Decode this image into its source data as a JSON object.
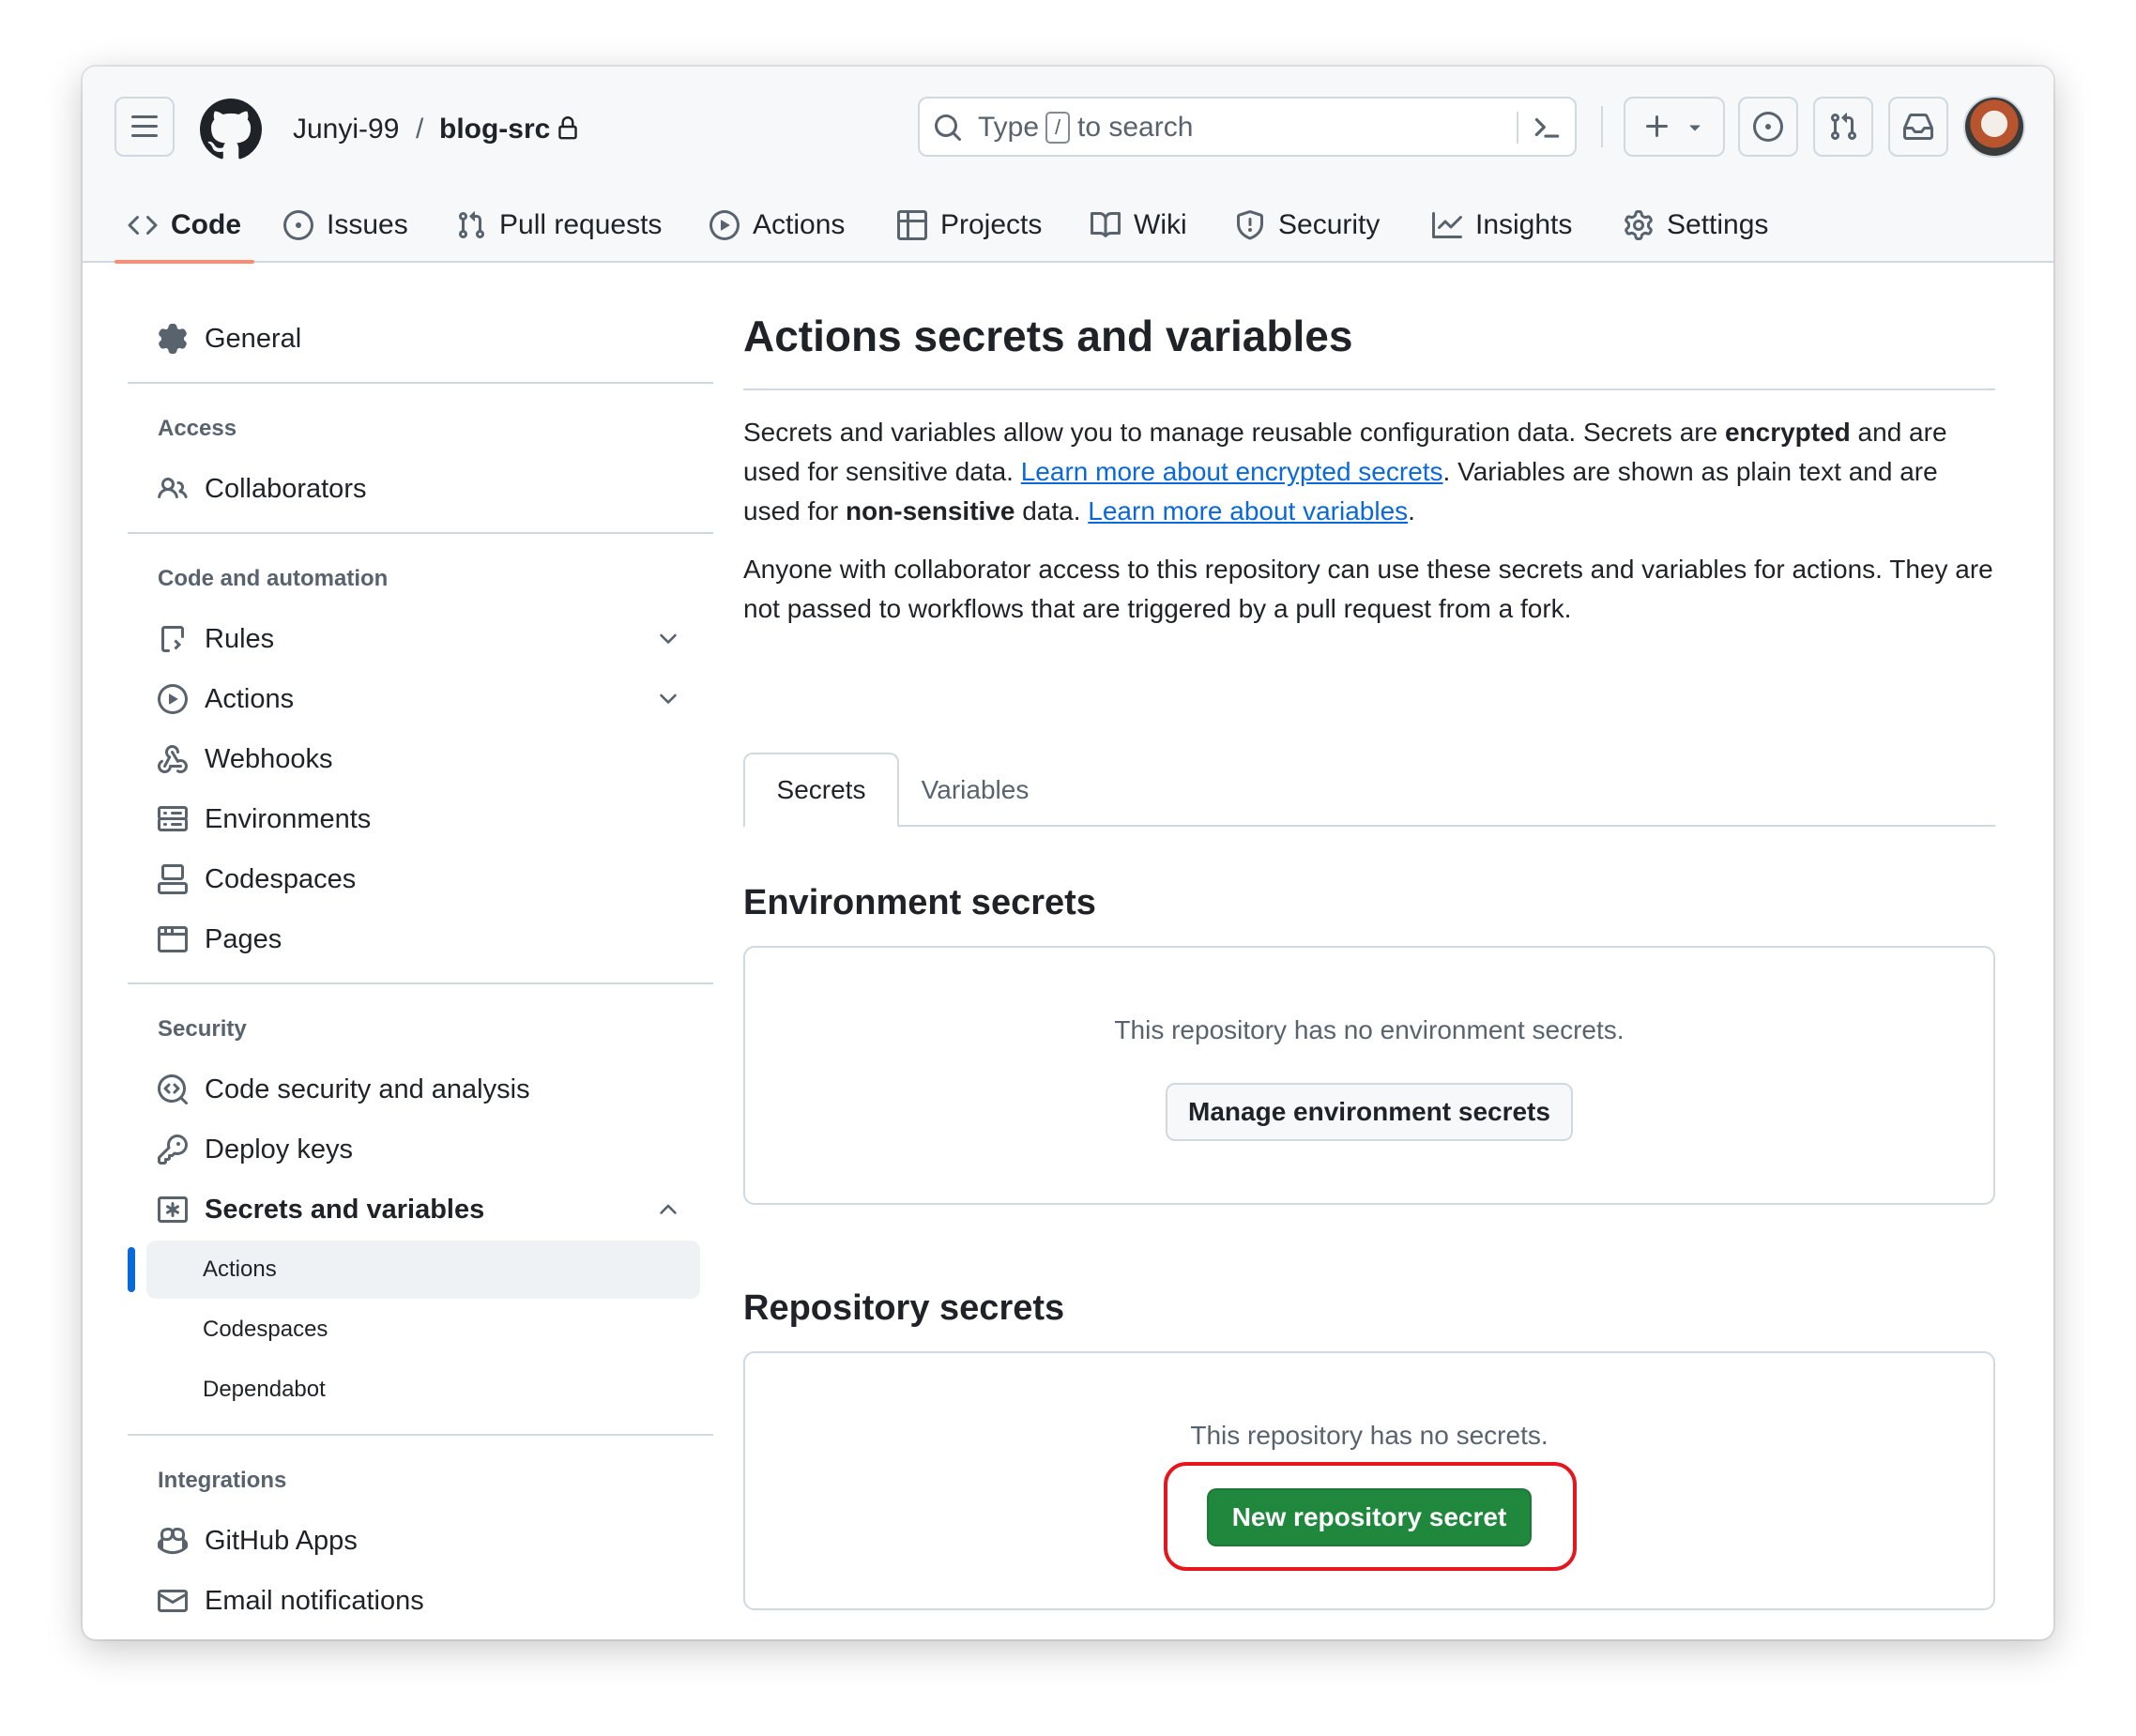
{
  "repo": {
    "owner": "Junyi-99",
    "separator": "/",
    "name": "blog-src"
  },
  "search": {
    "prefix": "Type",
    "key": "/",
    "suffix": "to search"
  },
  "nav_tabs": [
    {
      "label": "Code",
      "icon": "code-icon"
    },
    {
      "label": "Issues",
      "icon": "issue-icon"
    },
    {
      "label": "Pull requests",
      "icon": "pull-request-icon"
    },
    {
      "label": "Actions",
      "icon": "play-icon"
    },
    {
      "label": "Projects",
      "icon": "table-icon"
    },
    {
      "label": "Wiki",
      "icon": "book-icon"
    },
    {
      "label": "Security",
      "icon": "shield-icon"
    },
    {
      "label": "Insights",
      "icon": "graph-icon"
    },
    {
      "label": "Settings",
      "icon": "gear-icon"
    }
  ],
  "sidebar": {
    "general": "General",
    "access_heading": "Access",
    "collaborators": "Collaborators",
    "code_heading": "Code and automation",
    "code_items": [
      "Rules",
      "Actions",
      "Webhooks",
      "Environments",
      "Codespaces",
      "Pages"
    ],
    "security_heading": "Security",
    "security_items": [
      "Code security and analysis",
      "Deploy keys",
      "Secrets and variables"
    ],
    "secrets_sub": [
      "Actions",
      "Codespaces",
      "Dependabot"
    ],
    "integrations_heading": "Integrations",
    "integration_items": [
      "GitHub Apps",
      "Email notifications"
    ]
  },
  "main": {
    "title": "Actions secrets and variables",
    "intro_1": "Secrets and variables allow you to manage reusable configuration data. Secrets are ",
    "intro_encrypted": "encrypted",
    "intro_2": " and are used for sensitive data. ",
    "link_secrets": "Learn more about encrypted secrets",
    "intro_3": ". Variables are shown as plain text and are used for ",
    "intro_nonsensitive": "non-sensitive",
    "intro_4": " data. ",
    "link_variables": "Learn more about variables",
    "intro_5": ".",
    "access_note": "Anyone with collaborator access to this repository can use these secrets and variables for actions. They are not passed to workflows that are triggered by a pull request from a fork.",
    "tabs": [
      "Secrets",
      "Variables"
    ],
    "env_heading": "Environment secrets",
    "env_empty": "This repository has no environment secrets.",
    "env_button": "Manage environment secrets",
    "repo_heading": "Repository secrets",
    "repo_empty": "This repository has no secrets.",
    "repo_button": "New repository secret"
  },
  "colors": {
    "accent_tab": "#fd8c73",
    "primary_button": "#1f883d",
    "link": "#0969da",
    "highlight_annotation": "#e5161e"
  }
}
